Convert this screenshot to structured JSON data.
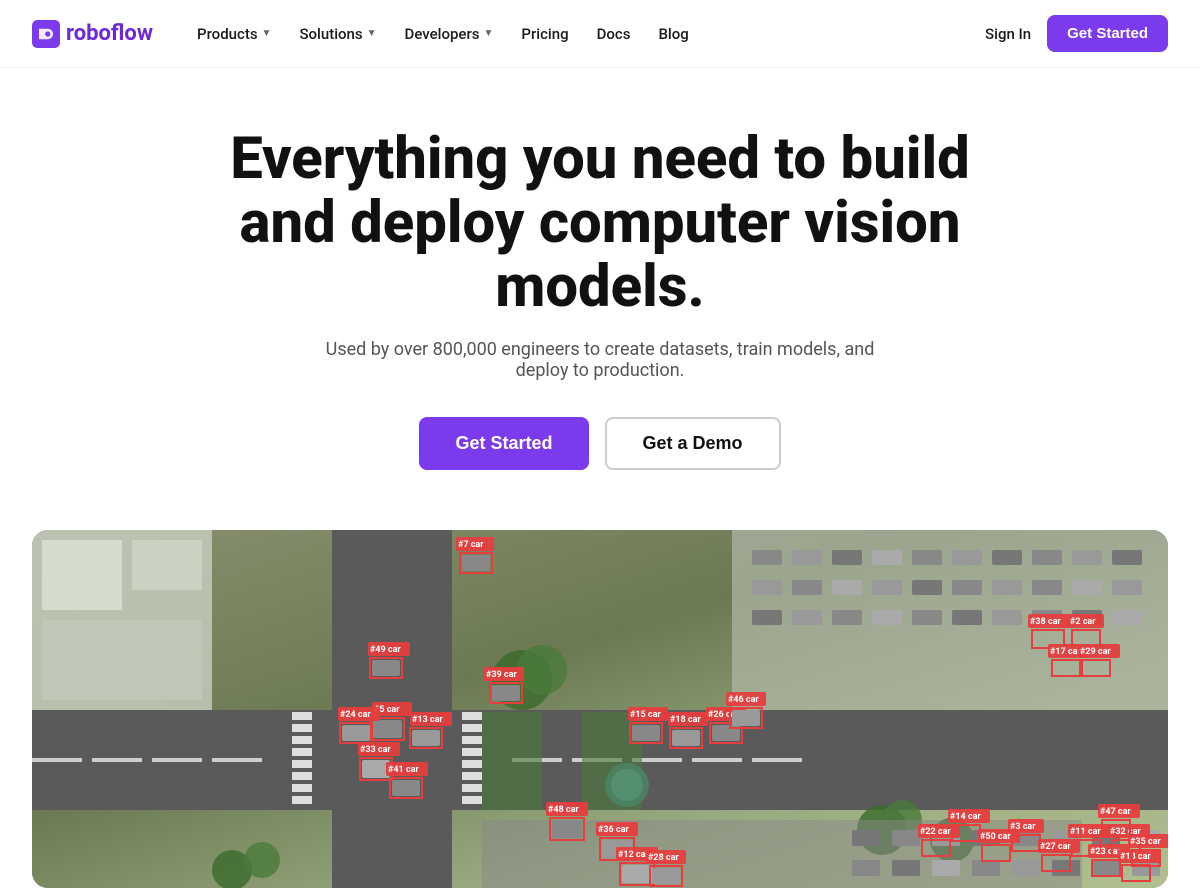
{
  "brand": {
    "name": "roboflow",
    "logo_alt": "Roboflow logo"
  },
  "nav": {
    "items": [
      {
        "label": "Products",
        "has_dropdown": true
      },
      {
        "label": "Solutions",
        "has_dropdown": true
      },
      {
        "label": "Developers",
        "has_dropdown": true
      },
      {
        "label": "Pricing",
        "has_dropdown": false
      },
      {
        "label": "Docs",
        "has_dropdown": false
      },
      {
        "label": "Blog",
        "has_dropdown": false
      }
    ],
    "sign_in": "Sign In",
    "get_started": "Get Started"
  },
  "hero": {
    "title": "Everything you need to build and deploy computer vision models.",
    "subtitle": "Used by over 800,000 engineers to create datasets, train models, and deploy to production.",
    "cta_primary": "Get Started",
    "cta_secondary": "Get a Demo"
  },
  "colors": {
    "brand_purple": "#7c3aed",
    "detection_red": "#e53e3e"
  }
}
